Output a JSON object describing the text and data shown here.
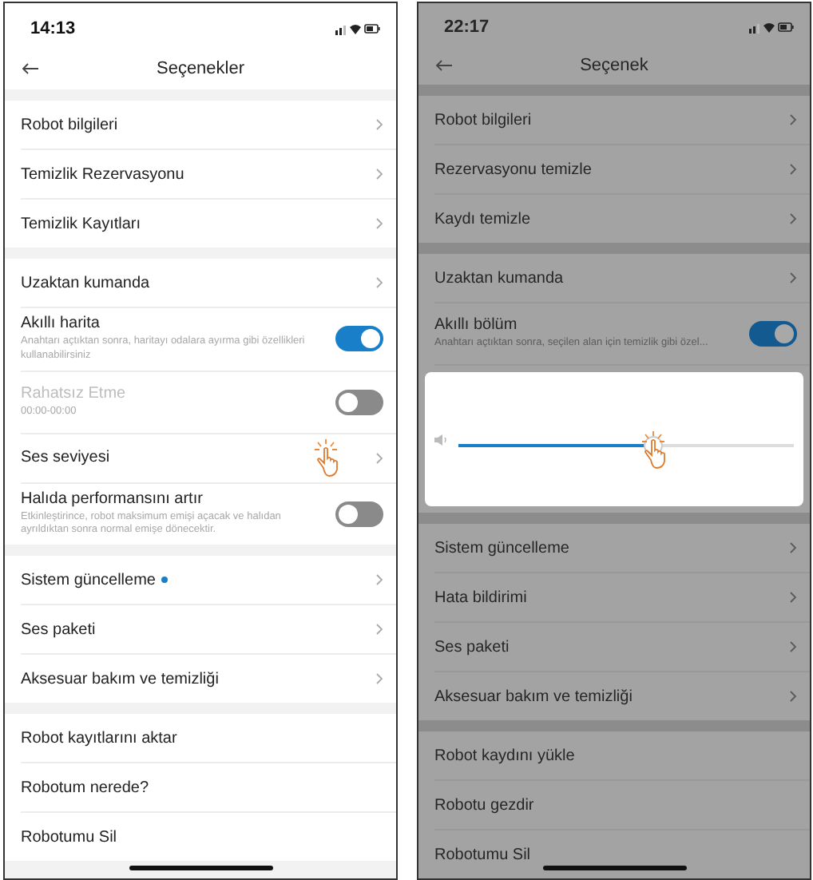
{
  "screens": [
    {
      "time": "14:13",
      "title": "Seçenekler",
      "dimmed": false,
      "sections": [
        [
          {
            "kind": "link",
            "label": "Robot bilgileri"
          },
          {
            "kind": "link",
            "label": "Temizlik Rezervasyonu"
          },
          {
            "kind": "link",
            "label": "Temizlik Kayıtları"
          }
        ],
        [
          {
            "kind": "link",
            "label": "Uzaktan kumanda"
          },
          {
            "kind": "toggle",
            "label": "Akıllı harita",
            "description": "Anahtarı açtıktan sonra, haritayı odalara ayırma gibi özellikleri kullanabilirsiniz",
            "on": true,
            "disabled": false
          },
          {
            "kind": "toggle",
            "label": "Rahatsız Etme",
            "description": "00:00-00:00",
            "on": false,
            "disabled": true
          },
          {
            "kind": "link",
            "label": "Ses seviyesi",
            "touch": true
          },
          {
            "kind": "toggle",
            "label": "Halıda performansını artır",
            "description": "Etkinleştirince, robot maksimum emişi açacak ve halıdan ayrıldıktan sonra normal emişe dönecektir.",
            "on": false,
            "disabled": false
          }
        ],
        [
          {
            "kind": "link",
            "label": "Sistem güncelleme",
            "dot": true
          },
          {
            "kind": "link",
            "label": "Ses paketi"
          },
          {
            "kind": "link",
            "label": "Aksesuar bakım ve temizliği"
          }
        ],
        [
          {
            "kind": "plain",
            "label": "Robot kayıtlarını aktar"
          },
          {
            "kind": "plain",
            "label": "Robotum nerede?"
          },
          {
            "kind": "plain",
            "label": "Robotumu Sil"
          }
        ]
      ]
    },
    {
      "time": "22:17",
      "title": "Seçenek",
      "dimmed": true,
      "sections": [
        [
          {
            "kind": "link",
            "label": "Robot bilgileri"
          },
          {
            "kind": "link",
            "label": "Rezervasyonu temizle"
          },
          {
            "kind": "link",
            "label": "Kaydı temizle"
          }
        ],
        [
          {
            "kind": "link",
            "label": "Uzaktan kumanda"
          },
          {
            "kind": "toggle",
            "label": "Akıllı bölüm",
            "description": "Anahtarı açtıktan sonra, seçilen alan için temizlik gibi özel...",
            "on": true,
            "disabled": false
          },
          {
            "kind": "volume",
            "level": 0.58,
            "touch": true
          }
        ],
        [
          {
            "kind": "link",
            "label": "Sistem güncelleme"
          },
          {
            "kind": "link",
            "label": "Hata bildirimi"
          },
          {
            "kind": "link",
            "label": "Ses paketi"
          },
          {
            "kind": "link",
            "label": "Aksesuar bakım ve temizliği"
          }
        ],
        [
          {
            "kind": "plain",
            "label": "Robot kaydını yükle"
          },
          {
            "kind": "plain",
            "label": "Robotu gezdir"
          },
          {
            "kind": "plain",
            "label": "Robotumu Sil"
          }
        ]
      ]
    }
  ]
}
